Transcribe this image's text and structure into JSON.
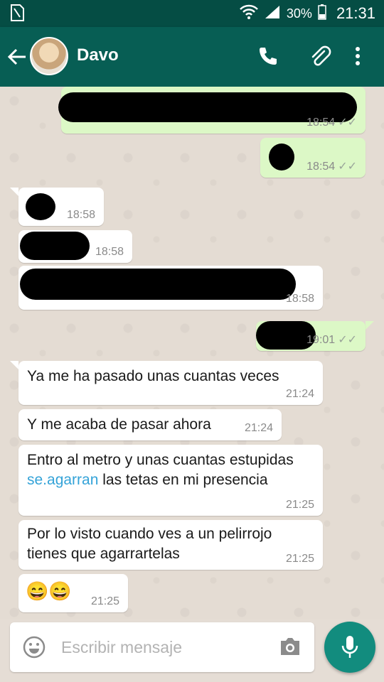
{
  "status": {
    "battery_percent": "30%",
    "time": "21:31"
  },
  "header": {
    "contact_name": "Davo"
  },
  "colors": {
    "appbar": "#075e54",
    "statusbar": "#054d44",
    "outgoing": "#dcf8c6",
    "incoming": "#ffffff",
    "accent": "#128c7e",
    "link": "#34a3d8"
  },
  "messages": [
    {
      "dir": "out",
      "text": "",
      "time": "18:54",
      "redacted": true
    },
    {
      "dir": "out",
      "text": "",
      "time": "18:54",
      "redacted": true
    },
    {
      "dir": "in",
      "text": "",
      "time": "18:58",
      "redacted": true
    },
    {
      "dir": "in",
      "text": "",
      "time": "18:58",
      "redacted": true
    },
    {
      "dir": "in",
      "text": "",
      "time": "18:58",
      "redacted": true
    },
    {
      "dir": "out",
      "text": "",
      "time": "19:01",
      "redacted": true
    },
    {
      "dir": "in",
      "text": "Ya me ha pasado unas cuantas veces",
      "time": "21:24"
    },
    {
      "dir": "in",
      "text": "Y me acaba de pasar ahora",
      "time": "21:24"
    },
    {
      "dir": "in",
      "text_before": "Entro al metro y unas cuantas estupidas ",
      "link": "se.agarran",
      "text_after": " las tetas en mi presencia",
      "time": "21:25"
    },
    {
      "dir": "in",
      "text": "Por lo visto cuando ves a un pelirrojo tienes que agarrartelas",
      "time": "21:25"
    },
    {
      "dir": "in",
      "text": "😄😄",
      "time": "21:25"
    }
  ],
  "input": {
    "placeholder": "Escribir mensaje"
  },
  "icons": [
    "sim-icon",
    "wifi-icon",
    "signal-icon",
    "battery-icon",
    "back-arrow-icon",
    "phone-icon",
    "attach-icon",
    "more-vert-icon",
    "emoji-icon",
    "camera-icon",
    "mic-icon",
    "double-check-icon"
  ]
}
